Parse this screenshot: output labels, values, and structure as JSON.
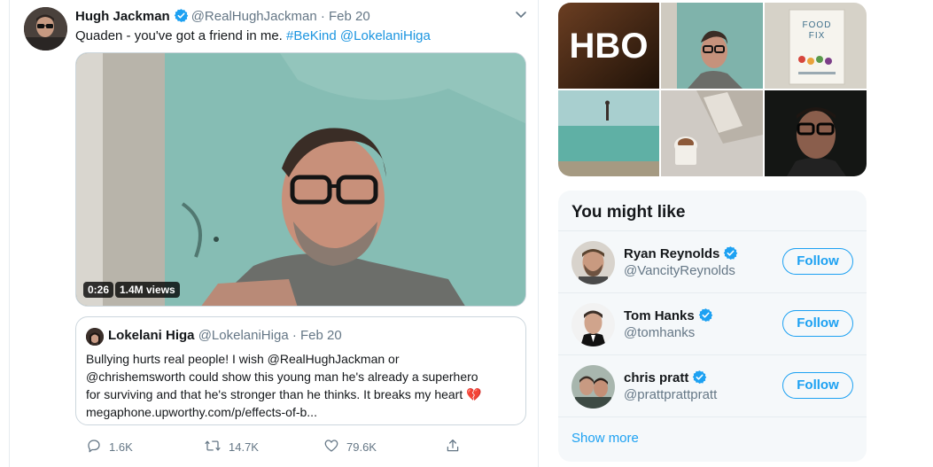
{
  "tweet": {
    "author_name": "Hugh Jackman",
    "author_handle": "@RealHughJackman",
    "separator": "·",
    "date": "Feb 20",
    "text_plain": "Quaden - you've got a friend in me. ",
    "hashtag": "#BeKind",
    "mention": "@LokelaniHiga",
    "video": {
      "duration": "0:26",
      "views": "1.4M views"
    },
    "quote": {
      "author_name": "Lokelani Higa",
      "author_handle": "@LokelaniHiga",
      "date": "Feb 20",
      "lines": [
        "Bullying hurts real people! I wish @RealHughJackman or",
        "@chrishemsworth could show this young man he's already a superhero",
        "for surviving and that he's stronger than he thinks. It breaks my heart",
        "megaphone.upworthy.com/p/effects-of-b..."
      ],
      "emoji": "💔"
    },
    "actions": {
      "replies": "1.6K",
      "retweets": "14.7K",
      "likes": "79.6K"
    }
  },
  "media_grid": {
    "tiles": [
      "hbo-logo",
      "hugh-selfie",
      "food-fix-book",
      "beach",
      "coffee-table",
      "hugh-car"
    ],
    "hbo_text": "HBO",
    "book_title_1": "FOOD",
    "book_title_2": "FIX"
  },
  "who_to_follow": {
    "title": "You might like",
    "follow_label": "Follow",
    "users": [
      {
        "name": "Ryan Reynolds",
        "handle": "@VancityReynolds"
      },
      {
        "name": "Tom Hanks",
        "handle": "@tomhanks"
      },
      {
        "name": "chris pratt",
        "handle": "@prattprattpratt"
      }
    ],
    "show_more": "Show more"
  },
  "colors": {
    "accent": "#1da1f2",
    "link": "#1b95e0",
    "muted": "#657786",
    "panel": "#f5f8fa",
    "border": "#e6ecf0"
  }
}
